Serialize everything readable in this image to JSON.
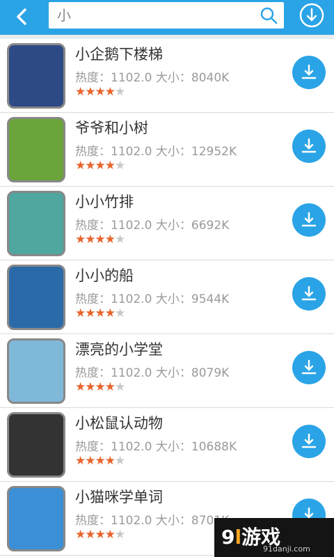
{
  "header": {
    "back_icon": "chevron-left-icon",
    "search_value": "小",
    "search_icon": "search-icon",
    "download_icon": "download-circle-icon"
  },
  "apps": [
    {
      "name": "小企鹅下楼梯",
      "heat_label": "热度：",
      "heat": "1102.0",
      "size_label": "大小：",
      "size": "8040K",
      "rating": 4,
      "rating_max": 5,
      "thumb_color": "#2e4a86"
    },
    {
      "name": "爷爷和小树",
      "heat_label": "热度：",
      "heat": "1102.0",
      "size_label": "大小：",
      "size": "12952K",
      "rating": 4,
      "rating_max": 5,
      "thumb_color": "#6aa43a"
    },
    {
      "name": "小小竹排",
      "heat_label": "热度：",
      "heat": "1102.0",
      "size_label": "大小：",
      "size": "6692K",
      "rating": 4,
      "rating_max": 5,
      "thumb_color": "#4fa7a0"
    },
    {
      "name": "小小的船",
      "heat_label": "热度：",
      "heat": "1102.0",
      "size_label": "大小：",
      "size": "9544K",
      "rating": 4,
      "rating_max": 5,
      "thumb_color": "#2a6aa8"
    },
    {
      "name": "漂亮的小学堂",
      "heat_label": "热度：",
      "heat": "1102.0",
      "size_label": "大小：",
      "size": "8079K",
      "rating": 4,
      "rating_max": 5,
      "thumb_color": "#7fb8d8"
    },
    {
      "name": "小松鼠认动物",
      "heat_label": "热度：",
      "heat": "1102.0",
      "size_label": "大小：",
      "size": "10688K",
      "rating": 4,
      "rating_max": 5,
      "thumb_color": "#333333"
    },
    {
      "name": "小猫咪学单词",
      "heat_label": "热度：",
      "heat": "1102.0",
      "size_label": "大小：",
      "size": "8701K",
      "rating": 4,
      "rating_max": 5,
      "thumb_color": "#3b8fd6"
    }
  ],
  "watermark": {
    "logo_main": "9",
    "logo_accent": "l",
    "logo_text": "游戏",
    "url": "91danji.com"
  },
  "colors": {
    "accent": "#2aa4e6",
    "star": "#e8642c",
    "star_empty": "#c8c8c8"
  }
}
